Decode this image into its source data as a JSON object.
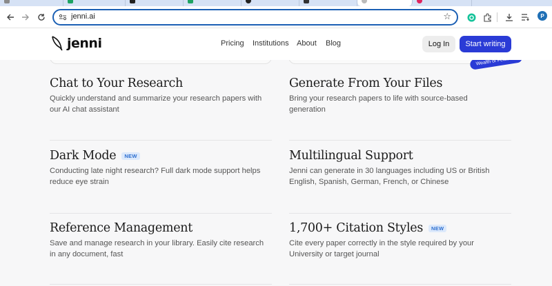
{
  "browser": {
    "url": "jenni.ai",
    "profile_initial": "P"
  },
  "header": {
    "logo_text": "jenni",
    "nav": [
      "Pricing",
      "Institutions",
      "About",
      "Blog"
    ],
    "login_label": "Log In",
    "cta_label": "Start writing"
  },
  "ribbon_text": "Wealth of Features",
  "features": [
    {
      "title": "Chat to Your Research",
      "badge": "",
      "desc_lines": [
        "Quickly understand and summarize your research papers with",
        "our AI chat assistant"
      ]
    },
    {
      "title": "Generate From Your Files",
      "badge": "",
      "desc_lines": [
        "Bring your research papers to life with source-based",
        "generation"
      ]
    },
    {
      "title": "Dark Mode",
      "badge": "NEW",
      "desc_lines": [
        "Conducting late night research? Full dark mode support helps",
        "reduce eye strain"
      ]
    },
    {
      "title": "Multilingual Support",
      "badge": "",
      "desc_lines": [
        "Jenni can generate in 30 languages including US or British",
        "English, Spanish, German, French, or Chinese"
      ]
    },
    {
      "title": "Reference Management",
      "badge": "",
      "desc_lines": [
        "Save and manage research in your library. Easily cite research",
        "in any document, fast"
      ]
    },
    {
      "title": "1,700+ Citation Styles",
      "badge": "NEW",
      "desc_lines": [
        "Cite every paper correctly in the style required by your",
        "University or target journal"
      ]
    }
  ],
  "colors": {
    "accent": "#2a3bd6",
    "badge_text": "#2d6fd0",
    "badge_bg": "#dce9fb",
    "omnibox_border": "#1a5fb4"
  }
}
